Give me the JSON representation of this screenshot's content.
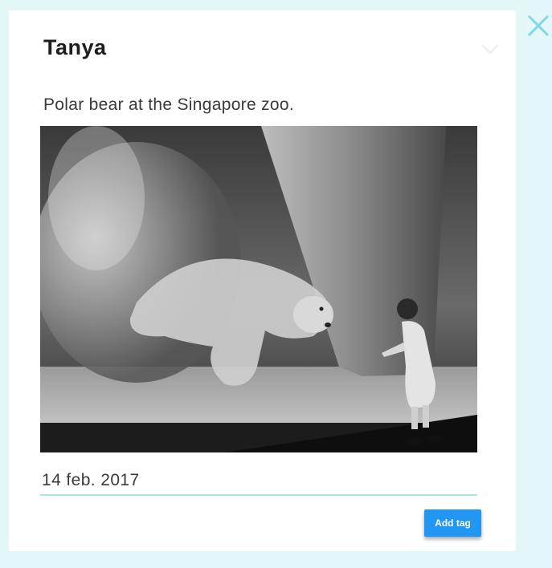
{
  "dialog": {
    "title": "Tanya",
    "caption": "Polar bear at the Singapore zoo.",
    "date_value": "14 feb. 2017",
    "add_tag_label": "Add tag",
    "close_icon": "close-icon",
    "collapse_icon": "chevron-down-icon"
  },
  "colors": {
    "page_background": "#e3f6f8",
    "accent": "#2196f3",
    "close_icon": "#7fd9e6",
    "field_underline": "#a6e3eb"
  }
}
